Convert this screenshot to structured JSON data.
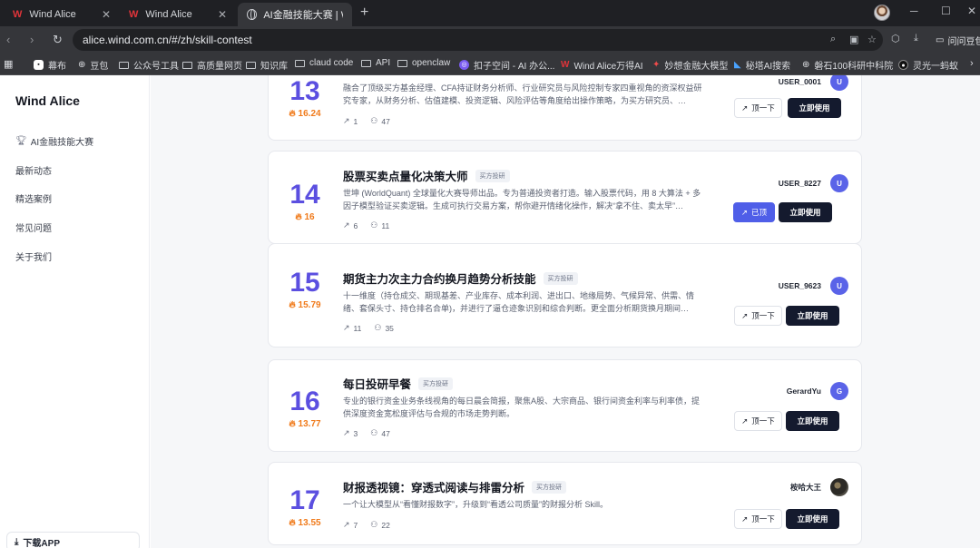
{
  "browser": {
    "tabs": [
      {
        "label": "Wind Alice",
        "icon": "W"
      },
      {
        "label": "Wind Alice",
        "icon": "W"
      },
      {
        "label": "AI金融技能大赛 | Wind"
      }
    ],
    "url": "alice.wind.com.cn/#/zh/skill-contest",
    "ask_label": "问问豆包",
    "bookmarks": [
      "幕布",
      "豆包",
      "公众号工具",
      "高质量网页",
      "知识库",
      "claud code",
      "API",
      "openclaw",
      "扣子空间 - AI 办公...",
      "Wind Alice万得AI",
      "妙想金融大模型",
      "秘塔AI搜索",
      "磐石100科研中科院",
      "灵光一蚂蚁"
    ]
  },
  "sidebar": {
    "brand": "Wind Alice",
    "items": [
      "AI金融技能大赛",
      "最新动态",
      "精选案例",
      "常见问题",
      "关于我们"
    ],
    "download_label": "下载APP"
  },
  "cards": [
    {
      "rank": "13",
      "score": "16.24",
      "title": "",
      "tag": "",
      "desc": "融合了顶级买方基金经理、CFA持证财务分析师、行业研究员与风险控制专家四重视角的资深权益研究专家，从财务分析、估值建模、投资逻辑、风险评估等角度给出操作策略，为买方研究员、…",
      "trend": "1",
      "users": "47",
      "author": "USER_0001",
      "avatar": "U",
      "upvote": "顶一下",
      "voted": false,
      "use": "立即使用"
    },
    {
      "rank": "14",
      "score": "16",
      "title": "股票买卖点量化决策大师",
      "tag": "买方投研",
      "desc": "世坤 (WorldQuant) 全球量化大赛导师出品。专为普通投资者打造。输入股票代码，用 8 大算法 + 多因子模型验证买卖逻辑。生成可执行交易方案，帮你避开情绪化操作，解决“拿不住、卖太早”…",
      "trend": "6",
      "users": "11",
      "author": "USER_8227",
      "avatar": "U",
      "upvote": "已顶",
      "voted": true,
      "use": "立即使用"
    },
    {
      "rank": "15",
      "score": "15.79",
      "title": "期货主力次主力合约换月趋势分析技能",
      "tag": "买方投研",
      "desc": "十一维度（持仓成交、期现基差、产业库存、成本利润、进出口、地缘局势、气候异常、供需、情绪、套保头寸、持仓排名合单)，并进行了逼仓迹象识别和综合判断。更全面分析期货换月期间…",
      "trend": "11",
      "users": "35",
      "author": "USER_9623",
      "avatar": "U",
      "upvote": "顶一下",
      "voted": false,
      "use": "立即使用"
    },
    {
      "rank": "16",
      "score": "13.77",
      "title": "每日投研早餐",
      "tag": "买方投研",
      "desc": "专业的银行资金业务条线视角的每日晨会简报，聚焦A股、大宗商品、银行间资金利率与利率债，提供深度资金宽松度评估与合规的市场走势判断。",
      "trend": "3",
      "users": "47",
      "author": "GerardYu",
      "avatar": "G",
      "upvote": "顶一下",
      "voted": false,
      "use": "立即使用"
    },
    {
      "rank": "17",
      "score": "13.55",
      "title": "财报透视镜：穿透式阅读与排雷分析",
      "tag": "买方投研",
      "desc": "一个让大模型从“看懂财报数字”，升级到“看透公司质量”的财报分析 Skill。",
      "trend": "7",
      "users": "22",
      "author": "桉哈大王",
      "avatar": "",
      "upvote": "顶一下",
      "voted": false,
      "use": "立即使用"
    }
  ]
}
